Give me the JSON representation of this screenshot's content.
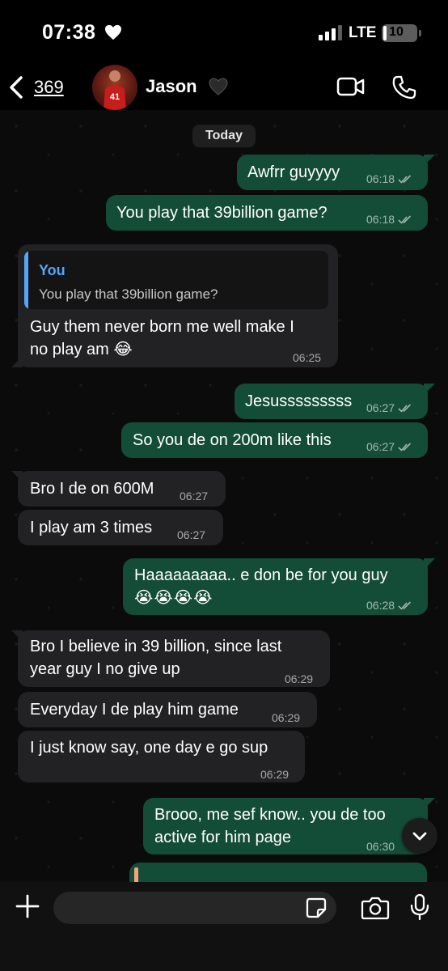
{
  "status_bar": {
    "time": "07:38",
    "network": "LTE",
    "battery_level": "10",
    "battery_fraction": 0.1
  },
  "header": {
    "back_count": "369",
    "contact_name": "Jason",
    "avatar_jersey": "41"
  },
  "chat": {
    "date_label": "Today",
    "messages": [
      {
        "text": "Awfrr guyyyy",
        "time": "06:18"
      },
      {
        "text": "You play that 39billion game?",
        "time": "06:18"
      },
      {
        "quote_author": "You",
        "quote_text": "You play that 39billion game?",
        "line1": "Guy them never born me well make I",
        "line2": "no play am 😂",
        "time": "06:25"
      },
      {
        "text": "Jesusssssssss",
        "time": "06:27"
      },
      {
        "text": "So you de on 200m like this",
        "time": "06:27"
      },
      {
        "text": "Bro I de on 600M",
        "time": "06:27"
      },
      {
        "text": "I play am 3 times",
        "time": "06:27"
      },
      {
        "line1": "Haaaaaaaaa.. e don be for you guy",
        "line2": "😭😭😭😭",
        "time": "06:28"
      },
      {
        "line1": "Bro I believe in 39 billion, since last",
        "line2": "year guy I no give up",
        "time": "06:29"
      },
      {
        "text": "Everyday I de play him game",
        "time": "06:29"
      },
      {
        "text": "I just know say, one day e go sup",
        "time": "06:29"
      },
      {
        "line1": "Brooo, me sef know.. you de too",
        "line2": "active for him page",
        "time": "06:30"
      }
    ]
  },
  "input": {
    "placeholder": ""
  },
  "colors": {
    "outgoing_bubble": "#144d37",
    "incoming_bubble": "#222224",
    "quote_accent": "#53a6fa",
    "background": "#0b0b0b"
  },
  "icons": [
    "heart-icon",
    "signal-icon",
    "back-chevron-icon",
    "video-call-icon",
    "phone-call-icon",
    "double-check-icon",
    "chevron-down-icon",
    "plus-icon",
    "sticker-icon",
    "camera-icon",
    "microphone-icon"
  ]
}
